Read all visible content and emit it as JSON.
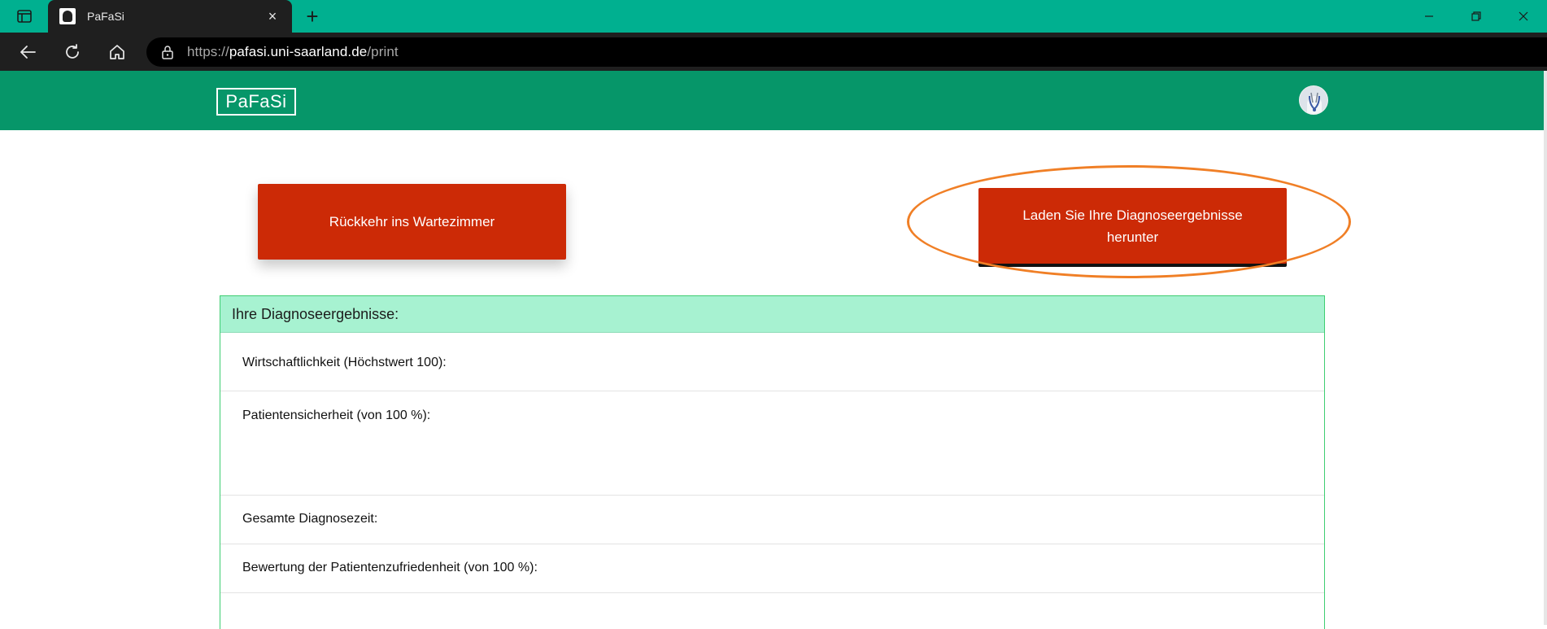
{
  "browser": {
    "tab_title": "PaFaSi",
    "tab_close": "×",
    "new_tab": "+",
    "url_scheme": "https://",
    "url_host": "pafasi.uni-saarland.de",
    "url_path": "/print"
  },
  "site": {
    "logo": "PaFaSi",
    "accent_color": "#069669",
    "button_color": "#cc2a06"
  },
  "actions": {
    "back_label": "Rückkehr ins Wartezimmer",
    "download_label": "Laden Sie Ihre Diagnoseergebnisse herunter"
  },
  "results": {
    "title": "Ihre Diagnoseergebnisse:",
    "rows": [
      {
        "label": "Wirtschaftlichkeit (Höchstwert 100):"
      },
      {
        "label": "Patientensicherheit (von 100 %):"
      },
      {
        "label": "Gesamte Diagnosezeit:"
      },
      {
        "label": "Bewertung der Patientenzufriedenheit (von 100 %):"
      }
    ]
  },
  "annotation": {
    "highlight_color": "#f07f26"
  }
}
